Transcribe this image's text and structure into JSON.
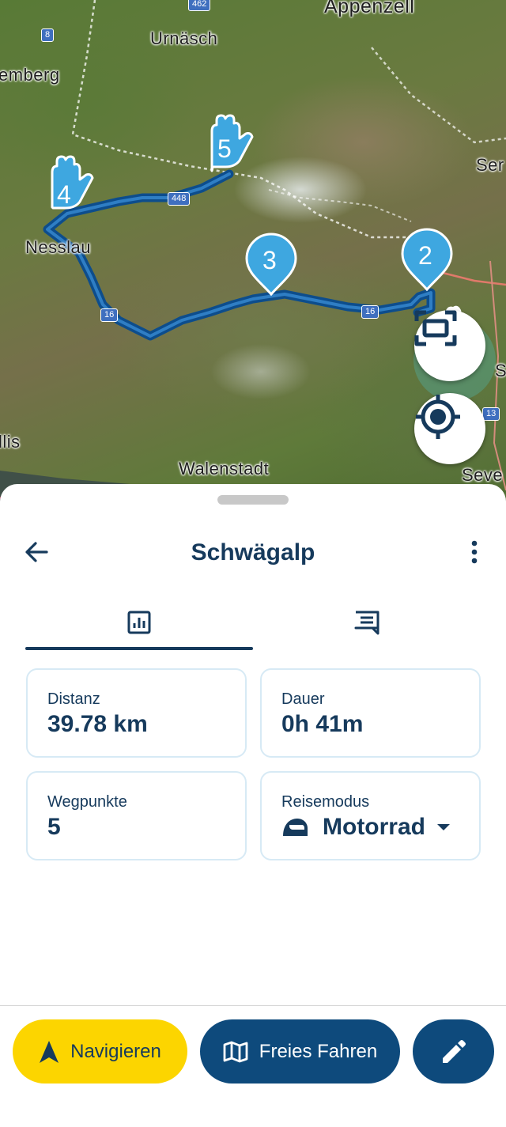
{
  "map": {
    "places": {
      "appenzell": "Appenzell",
      "urnaesch": "Urnäsch",
      "gossau": "emberg",
      "nesslau": "Nesslau",
      "walenstadt": "Walenstadt",
      "sennwald": "Ser",
      "sargans": "Seve",
      "amden": "llis",
      "s": "S"
    },
    "roads": {
      "r462": "462",
      "r8": "8",
      "r448": "448",
      "r16a": "16",
      "r16b": "16",
      "r13": "13"
    },
    "waypoints": {
      "wp2": "2",
      "wp3": "3",
      "wp4": "4",
      "wp5": "5"
    },
    "route_color": "#0d4d8c",
    "pin_color": "#3ea7e0",
    "fit_icon": "fit-route-icon",
    "locate_icon": "my-location-icon"
  },
  "sheet": {
    "title": "Schwägalp",
    "back_icon": "back-arrow-icon",
    "menu_icon": "more-vertical-icon",
    "tabs": [
      {
        "icon": "statistics-icon",
        "active": true
      },
      {
        "icon": "comment-icon",
        "active": false
      }
    ],
    "stats": {
      "distance_label": "Distanz",
      "distance_value": "39.78 km",
      "duration_label": "Dauer",
      "duration_value": "0h 41m",
      "waypoints_label": "Wegpunkte",
      "waypoints_value": "5",
      "mode_label": "Reisemodus",
      "mode_value": "Motorrad",
      "mode_icon": "motorcycle-helmet-icon"
    }
  },
  "actions": {
    "navigate_label": "Navigieren",
    "free_ride_label": "Freies Fahren",
    "edit_icon": "pencil-icon",
    "navigate_color": "#fcd500",
    "primary_color": "#0e4a7c"
  }
}
